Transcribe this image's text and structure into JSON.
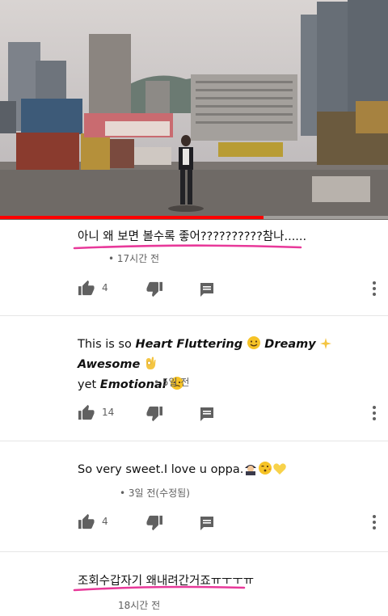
{
  "video": {
    "progress_fraction": 0.68
  },
  "comments": [
    {
      "text": "아니 왜 보면 볼수록 좋어??????????참나......",
      "meta": "• 17시간 전",
      "likes": "4",
      "highlight_color": "#e8399a"
    },
    {
      "text_parts": [
        "This is so ",
        "Heart Fluttering",
        " ",
        "Dreamy",
        " ",
        "Awesome",
        " ",
        "yet ",
        "Emotional"
      ],
      "meta": "• 5일 전",
      "likes": "14"
    },
    {
      "text": "So very sweet.I love u oppa.",
      "meta": "• 3일 전(수정됨)",
      "likes": "4"
    },
    {
      "text": "조회수갑자기 왜내려간거죠ㅠㅜㅜㅠ",
      "meta": "18시간 전",
      "highlight_color": "#e8399a"
    }
  ],
  "icons": [
    "thumbs-up-icon",
    "thumbs-down-icon",
    "reply-icon",
    "more-vert-icon"
  ],
  "colors": {
    "progress": "#ff0000",
    "icon": "#606060",
    "highlight": "#e8399a"
  }
}
